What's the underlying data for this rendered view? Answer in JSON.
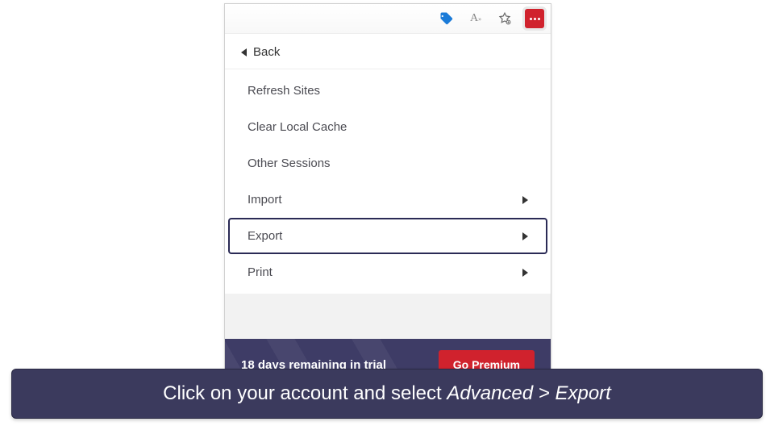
{
  "toolbar": {
    "icons": [
      "tag-icon",
      "text-icon",
      "favorite-icon",
      "extension-icon"
    ]
  },
  "back_label": "Back",
  "menu": {
    "refresh": "Refresh Sites",
    "clear_cache": "Clear Local Cache",
    "other_sessions": "Other Sessions",
    "import": "Import",
    "export": "Export",
    "print": "Print"
  },
  "trial": {
    "text": "18 days remaining in trial",
    "button": "Go Premium"
  },
  "caption": {
    "prefix": "Click on your account and select ",
    "italic": "Advanced > Export"
  }
}
